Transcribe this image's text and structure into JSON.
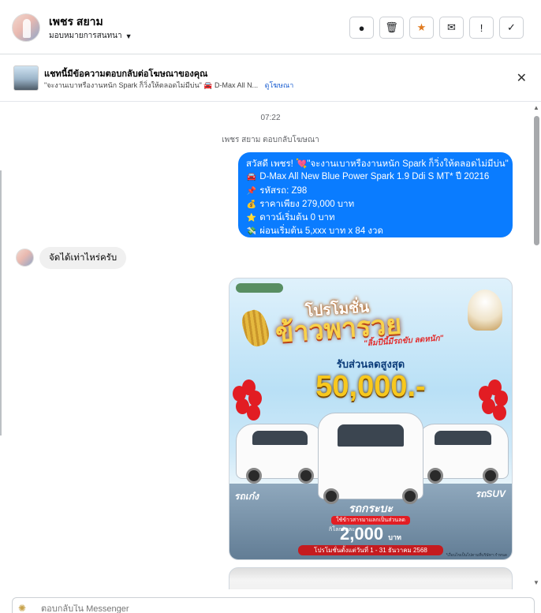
{
  "header": {
    "name": "เพชร สยาม",
    "assign_label": "มอบหมายการสนทนา",
    "actions": [
      {
        "icon": "info-alert-icon",
        "glyph": "●"
      },
      {
        "icon": "trash-icon",
        "glyph": "🗑"
      },
      {
        "icon": "star-icon",
        "glyph": "★"
      },
      {
        "icon": "mail-icon",
        "glyph": "✉"
      },
      {
        "icon": "exclamation-icon",
        "glyph": "!"
      },
      {
        "icon": "check-icon",
        "glyph": "✓"
      }
    ]
  },
  "ad_banner": {
    "title": "แชทนี้มีข้อความตอบกลับต่อโฆษณาของคุณ",
    "subtitle": "\"จะงานเบาหรืองานหนัก Spark ก็วิ่งให้ตลอดไม่มีบ่น\" 🚘 D-Max All N...",
    "link": "ดูโฆษณา"
  },
  "thread": {
    "time": "07:22",
    "reply_note": "เพชร สยาม ตอบกลับโฆษณา",
    "outgoing": {
      "lines": [
        {
          "emoji": "",
          "text": "สวัสดี เพชร! 💘\"จะงานเบาหรืองานหนัก Spark ก็วิ่งให้ตลอดไม่มีบ่น\""
        },
        {
          "emoji": "🚘",
          "text": "D-Max All New Blue Power Spark 1.9 Ddi S MT* ปี 20216"
        },
        {
          "emoji": "📌",
          "text": "รหัสรถ: Z98"
        },
        {
          "emoji": "💰",
          "text": "ราคาเพียง 279,000 บาท"
        },
        {
          "emoji": "⭐",
          "text": "ดาวน์เริ่มต้น 0 บาท"
        },
        {
          "emoji": "💸",
          "text": "ผ่อนเริ่มต้น 5,xxx บาท x 84 งวด"
        }
      ]
    },
    "incoming": {
      "text": "จัดได้เท่าไหร่ครับ"
    },
    "promo": {
      "title_top": "โปรโมชั่น",
      "title_main": "ข้าวพารวย",
      "tagline": "\"ลิ้มปีนี้มีรถขับ ลดหนัก\"",
      "discount_label": "รับส่วนลดสูงสุด",
      "amount": "50,000.-",
      "label_left": "รถเก๋ง",
      "label_mid": "รถกระบะ",
      "label_right": "รถSUV",
      "pill": "ใช้ข้าวสารมาแลกเป็นส่วนลด",
      "km_label": "กิโลกรัมละ",
      "km_value": "2,000",
      "km_unit": "บาท",
      "date": "โปรโมชั่นตั้งแต่วันที่ 1 - 31 ธันวาคม 2568",
      "footnote": "*เงื่อนไขเป็นไปตามที่บริษัทฯ กำหนด"
    }
  },
  "composer": {
    "placeholder": "ตอบกลับใน Messenger"
  }
}
